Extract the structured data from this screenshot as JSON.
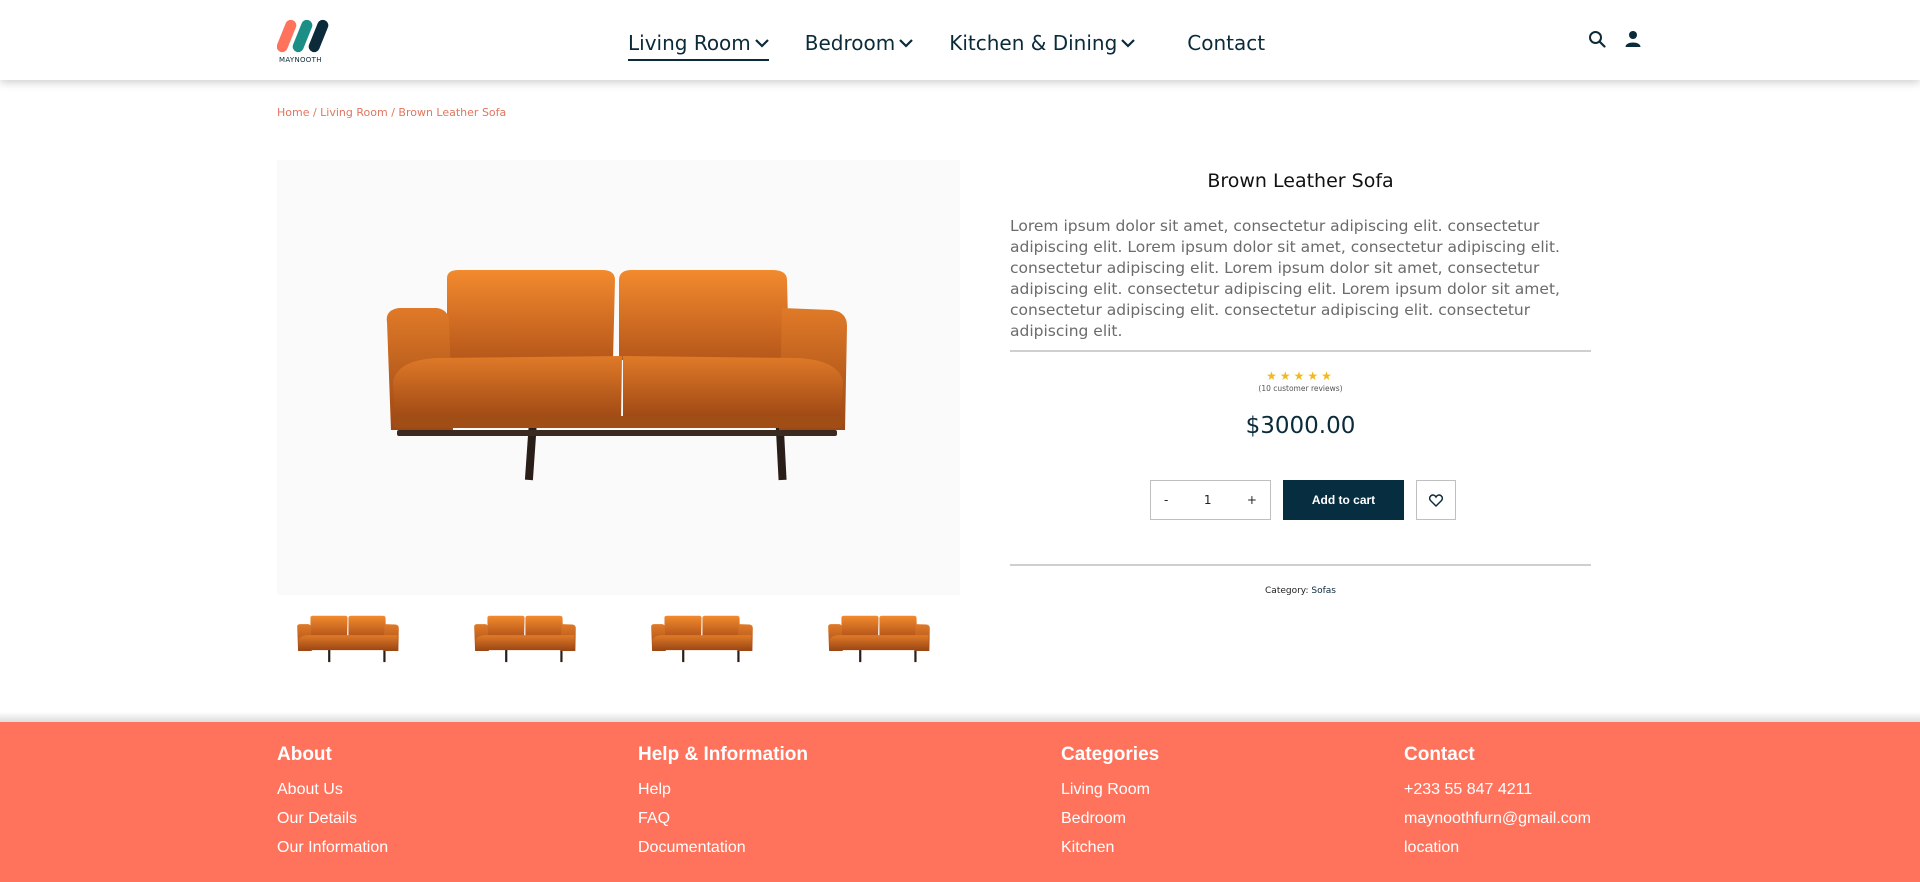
{
  "brand": {
    "logo_text": "MAYNOOTH",
    "colors": {
      "coral": "#ff735d",
      "teal": "#1b8f85",
      "navy": "#072e40"
    }
  },
  "nav": {
    "items": [
      {
        "label": "Living Room"
      },
      {
        "label": "Bedroom"
      },
      {
        "label": "Kitchen & Dining"
      },
      {
        "label": "Contact"
      }
    ],
    "active": "Living Room"
  },
  "header_icons": [
    "search-icon",
    "user-icon"
  ],
  "breadcrumb": "Home / Living Room / Brown Leather Sofa",
  "product": {
    "title": "Brown Leather Sofa",
    "description": "Lorem ipsum dolor sit amet, consectetur adipiscing elit. consectetur adipiscing elit. Lorem ipsum dolor sit amet, consectetur adipiscing elit. consectetur adipiscing elit. Lorem ipsum dolor sit amet, consectetur adipiscing elit. consectetur adipiscing elit. Lorem ipsum dolor sit amet, consectetur adipiscing elit. consectetur adipiscing elit. consectetur adipiscing elit.",
    "rating": 5,
    "stars": "★★★★★",
    "reviews": "(10 customer reviews)",
    "price": "$3000.00",
    "quantity": {
      "minus": "-",
      "value": "1",
      "plus": "+"
    },
    "add_to_cart": "Add to cart",
    "category_label": "Category:",
    "category_value": "Sofas"
  },
  "footer": {
    "about": {
      "title": "About",
      "links": [
        "About Us",
        "Our Details",
        "Our Information"
      ]
    },
    "help": {
      "title": "Help & Information",
      "links": [
        "Help",
        "FAQ",
        "Documentation"
      ]
    },
    "categories": {
      "title": "Categories",
      "links": [
        "Living Room",
        "Bedroom",
        "Kitchen"
      ]
    },
    "contact": {
      "title": "Contact",
      "links": [
        "+233 55 847 4211",
        "maynoothfurn@gmail.com",
        "location"
      ]
    }
  }
}
